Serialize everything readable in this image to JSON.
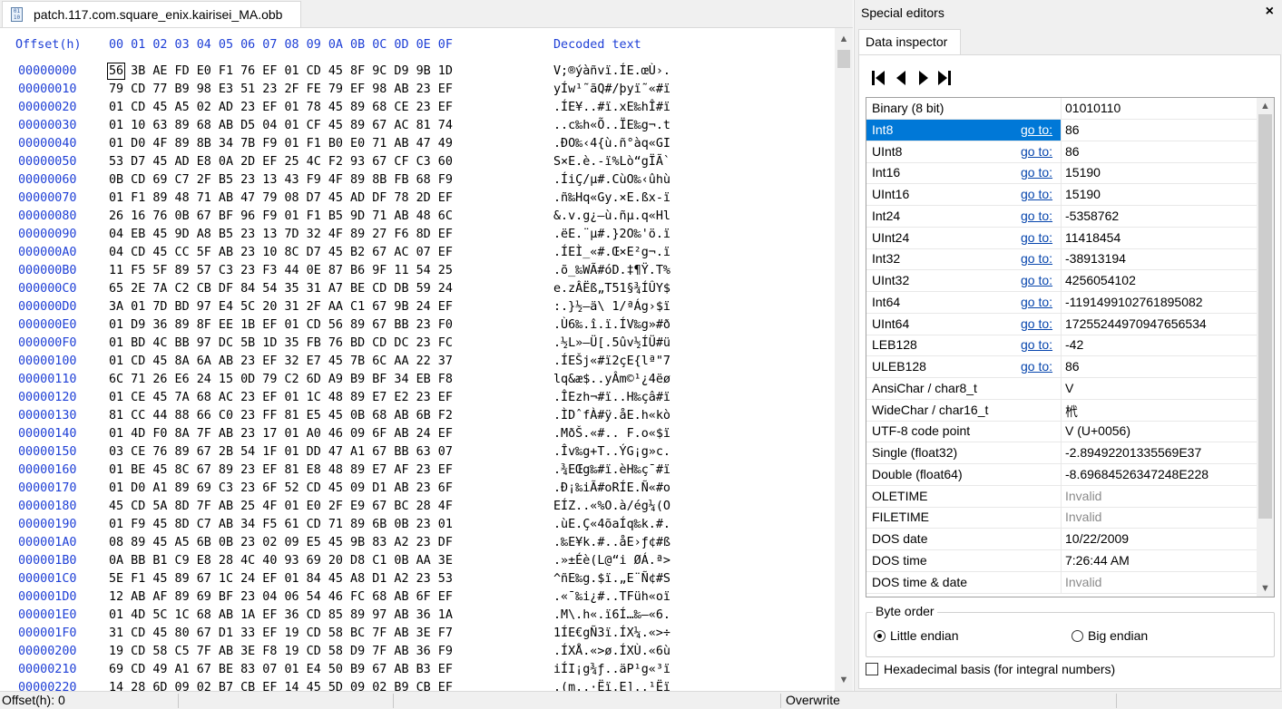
{
  "file_tab": {
    "icon": "file-icon",
    "icon_text": "01\n10",
    "name": "patch.117.com.square_enix.kairisei_MA.obb"
  },
  "hex": {
    "header_offset": "Offset(h)",
    "header_bytes": "00 01 02 03 04 05 06 07 08 09 0A 0B 0C 0D 0E 0F",
    "header_text": "Decoded text",
    "rows": [
      {
        "offset": "00000000",
        "bytes": "56 3B AE FD E0 F1 76 EF 01 CD 45 8F 9C D9 9B 1D",
        "text": "V;®ýàñvï.ÍE.œÙ›."
      },
      {
        "offset": "00000010",
        "bytes": "79 CD 77 B9 98 E3 51 23 2F FE 79 EF 98 AB 23 EF",
        "text": "yÍw¹˜ãQ#/þyï˜«#ï"
      },
      {
        "offset": "00000020",
        "bytes": "01 CD 45 A5 02 AD 23 EF 01 78 45 89 68 CE 23 EF",
        "text": ".ÍE¥..#ï.xE‰hÎ#ï"
      },
      {
        "offset": "00000030",
        "bytes": "01 10 63 89 68 AB D5 04 01 CF 45 89 67 AC 81 74",
        "text": "..c‰h«Õ..ÏE‰g¬.t"
      },
      {
        "offset": "00000040",
        "bytes": "01 D0 4F 89 8B 34 7B F9 01 F1 B0 E0 71 AB 47 49",
        "text": ".ÐO‰‹4{ù.ñ°àq«GI"
      },
      {
        "offset": "00000050",
        "bytes": "53 D7 45 AD E8 0A 2D EF 25 4C F2 93 67 CF C3 60",
        "text": "S×E.è.-ï%Lò“gÏÃ`"
      },
      {
        "offset": "00000060",
        "bytes": "0B CD 69 C7 2F B5 23 13 43 F9 4F 89 8B FB 68 F9",
        "text": ".ÍiÇ/µ#.CùO‰‹ûhù"
      },
      {
        "offset": "00000070",
        "bytes": "01 F1 89 48 71 AB 47 79 08 D7 45 AD DF 78 2D EF",
        "text": ".ñ‰Hq«Gy.×E.ßx-ï"
      },
      {
        "offset": "00000080",
        "bytes": "26 16 76 0B 67 BF 96 F9 01 F1 B5 9D 71 AB 48 6C",
        "text": "&.v.g¿–ù.ñµ.q«Hl"
      },
      {
        "offset": "00000090",
        "bytes": "04 EB 45 9D A8 B5 23 13 7D 32 4F 89 27 F6 8D EF",
        "text": ".ëE.¨µ#.}2O‰'ö.ï"
      },
      {
        "offset": "000000A0",
        "bytes": "04 CD 45 CC 5F AB 23 10 8C D7 45 B2 67 AC 07 EF",
        "text": ".ÍEÌ_«#.Œ×E²g¬.ï"
      },
      {
        "offset": "000000B0",
        "bytes": "11 F5 5F 89 57 C3 23 F3 44 0E 87 B6 9F 11 54 25",
        "text": ".õ_‰WÃ#óD.‡¶Ÿ.T%"
      },
      {
        "offset": "000000C0",
        "bytes": "65 2E 7A C2 CB DF 84 54 35 31 A7 BE CD DB 59 24",
        "text": "e.zÂËß„T51§¾ÍÛY$"
      },
      {
        "offset": "000000D0",
        "bytes": "3A 01 7D BD 97 E4 5C 20 31 2F AA C1 67 9B 24 EF",
        "text": ":.}½—ä\\ 1/ªÁg›$ï"
      },
      {
        "offset": "000000E0",
        "bytes": "01 D9 36 89 8F EE 1B EF 01 CD 56 89 67 BB 23 F0",
        "text": ".Ù6‰.î.ï.ÍV‰g»#ð"
      },
      {
        "offset": "000000F0",
        "bytes": "01 BD 4C BB 97 DC 5B 1D 35 FB 76 BD CD DC 23 FC",
        "text": ".½L»—Ü[.5ûv½ÍÜ#ü"
      },
      {
        "offset": "00000100",
        "bytes": "01 CD 45 8A 6A AB 23 EF 32 E7 45 7B 6C AA 22 37",
        "text": ".ÍEŠj«#ï2çE{lª\"7"
      },
      {
        "offset": "00000110",
        "bytes": "6C 71 26 E6 24 15 0D 79 C2 6D A9 B9 BF 34 EB F8",
        "text": "lq&æ$..yÂm©¹¿4ëø"
      },
      {
        "offset": "00000120",
        "bytes": "01 CE 45 7A 68 AC 23 EF 01 1C 48 89 E7 E2 23 EF",
        "text": ".ÎEzh¬#ï..H‰çâ#ï"
      },
      {
        "offset": "00000130",
        "bytes": "81 CC 44 88 66 C0 23 FF 81 E5 45 0B 68 AB 6B F2",
        "text": ".ÌDˆfÀ#ÿ.åE.h«kò"
      },
      {
        "offset": "00000140",
        "bytes": "01 4D F0 8A 7F AB 23 17 01 A0 46 09 6F AB 24 EF",
        "text": ".MðŠ.«#.. F.o«$ï"
      },
      {
        "offset": "00000150",
        "bytes": "03 CE 76 89 67 2B 54 1F 01 DD 47 A1 67 BB 63 07",
        "text": ".Îv‰g+T..ÝG¡g»c."
      },
      {
        "offset": "00000160",
        "bytes": "01 BE 45 8C 67 89 23 EF 81 E8 48 89 E7 AF 23 EF",
        "text": ".¾EŒg‰#ï.èH‰ç¯#ï"
      },
      {
        "offset": "00000170",
        "bytes": "01 D0 A1 89 69 C3 23 6F 52 CD 45 09 D1 AB 23 6F",
        "text": ".Ð¡‰iÃ#oRÍE.Ñ«#o"
      },
      {
        "offset": "00000180",
        "bytes": "45 CD 5A 8D 7F AB 25 4F 01 E0 2F E9 67 BC 28 4F",
        "text": "EÍZ..«%O.à/ég¼(O"
      },
      {
        "offset": "00000190",
        "bytes": "01 F9 45 8D C7 AB 34 F5 61 CD 71 89 6B 0B 23 01",
        "text": ".ùE.Ç«4õaÍq‰k.#."
      },
      {
        "offset": "000001A0",
        "bytes": "08 89 45 A5 6B 0B 23 02 09 E5 45 9B 83 A2 23 DF",
        "text": ".‰E¥k.#..åE›ƒ¢#ß"
      },
      {
        "offset": "000001B0",
        "bytes": "0A BB B1 C9 E8 28 4C 40 93 69 20 D8 C1 0B AA 3E",
        "text": ".»±Éè(L@“i ØÁ.ª>"
      },
      {
        "offset": "000001C0",
        "bytes": "5E F1 45 89 67 1C 24 EF 01 84 45 A8 D1 A2 23 53",
        "text": "^ñE‰g.$ï.„E¨Ñ¢#S"
      },
      {
        "offset": "000001D0",
        "bytes": "12 AB AF 89 69 BF 23 04 06 54 46 FC 68 AB 6F EF",
        "text": ".«¯‰i¿#..TFüh«oï"
      },
      {
        "offset": "000001E0",
        "bytes": "01 4D 5C 1C 68 AB 1A EF 36 CD 85 89 97 AB 36 1A",
        "text": ".M\\.h«.ï6Í…‰—«6."
      },
      {
        "offset": "000001F0",
        "bytes": "31 CD 45 80 67 D1 33 EF 19 CD 58 BC 7F AB 3E F7",
        "text": "1ÍE€gÑ3ï.ÍX¼.«>÷"
      },
      {
        "offset": "00000200",
        "bytes": "19 CD 58 C5 7F AB 3E F8 19 CD 58 D9 7F AB 36 F9",
        "text": ".ÍXÅ.«>ø.ÍXÙ.«6ù"
      },
      {
        "offset": "00000210",
        "bytes": "69 CD 49 A1 67 BE 83 07 01 E4 50 B9 67 AB B3 EF",
        "text": "iÍI¡g¾ƒ..äP¹g«³ï"
      },
      {
        "offset": "00000220",
        "bytes": "14 28 6D 09 02 B7 CB EF 14 45 5D 09 02 B9 CB EF",
        "text": ".(m..·Ëï.E]..¹Ëï"
      }
    ]
  },
  "special_editors": {
    "title": "Special editors",
    "close_label": "×",
    "inspector_tab": "Data inspector",
    "goto_label": "go to:",
    "rows": [
      {
        "name": "Binary (8 bit)",
        "goto": false,
        "value": "01010110",
        "selected": false,
        "invalid": false
      },
      {
        "name": "Int8",
        "goto": true,
        "value": "86",
        "selected": true,
        "invalid": false
      },
      {
        "name": "UInt8",
        "goto": true,
        "value": "86",
        "selected": false,
        "invalid": false
      },
      {
        "name": "Int16",
        "goto": true,
        "value": "15190",
        "selected": false,
        "invalid": false
      },
      {
        "name": "UInt16",
        "goto": true,
        "value": "15190",
        "selected": false,
        "invalid": false
      },
      {
        "name": "Int24",
        "goto": true,
        "value": "-5358762",
        "selected": false,
        "invalid": false
      },
      {
        "name": "UInt24",
        "goto": true,
        "value": "11418454",
        "selected": false,
        "invalid": false
      },
      {
        "name": "Int32",
        "goto": true,
        "value": "-38913194",
        "selected": false,
        "invalid": false
      },
      {
        "name": "UInt32",
        "goto": true,
        "value": "4256054102",
        "selected": false,
        "invalid": false
      },
      {
        "name": "Int64",
        "goto": true,
        "value": "-1191499102761895082",
        "selected": false,
        "invalid": false
      },
      {
        "name": "UInt64",
        "goto": true,
        "value": "17255244970947656534",
        "selected": false,
        "invalid": false
      },
      {
        "name": "LEB128",
        "goto": true,
        "value": "-42",
        "selected": false,
        "invalid": false
      },
      {
        "name": "ULEB128",
        "goto": true,
        "value": "86",
        "selected": false,
        "invalid": false
      },
      {
        "name": "AnsiChar / char8_t",
        "goto": false,
        "value": "V",
        "selected": false,
        "invalid": false
      },
      {
        "name": "WideChar / char16_t",
        "goto": false,
        "value": "㭖",
        "selected": false,
        "invalid": false
      },
      {
        "name": "UTF-8 code point",
        "goto": false,
        "value": "V (U+0056)",
        "selected": false,
        "invalid": false
      },
      {
        "name": "Single (float32)",
        "goto": false,
        "value": "-2.89492201335569E37",
        "selected": false,
        "invalid": false
      },
      {
        "name": "Double (float64)",
        "goto": false,
        "value": "-8.69684526347248E228",
        "selected": false,
        "invalid": false
      },
      {
        "name": "OLETIME",
        "goto": false,
        "value": "Invalid",
        "selected": false,
        "invalid": true
      },
      {
        "name": "FILETIME",
        "goto": false,
        "value": "Invalid",
        "selected": false,
        "invalid": true
      },
      {
        "name": "DOS date",
        "goto": false,
        "value": "10/22/2009",
        "selected": false,
        "invalid": false
      },
      {
        "name": "DOS time",
        "goto": false,
        "value": "7:26:44 AM",
        "selected": false,
        "invalid": false
      },
      {
        "name": "DOS time & date",
        "goto": false,
        "value": "Invalid",
        "selected": false,
        "invalid": true
      }
    ],
    "byte_order": {
      "legend": "Byte order",
      "little": "Little endian",
      "big": "Big endian",
      "selected": "little"
    },
    "hex_basis": {
      "label": "Hexadecimal basis (for integral numbers)",
      "checked": false
    }
  },
  "status": {
    "offset": "Offset(h): 0",
    "mode": "Overwrite"
  }
}
